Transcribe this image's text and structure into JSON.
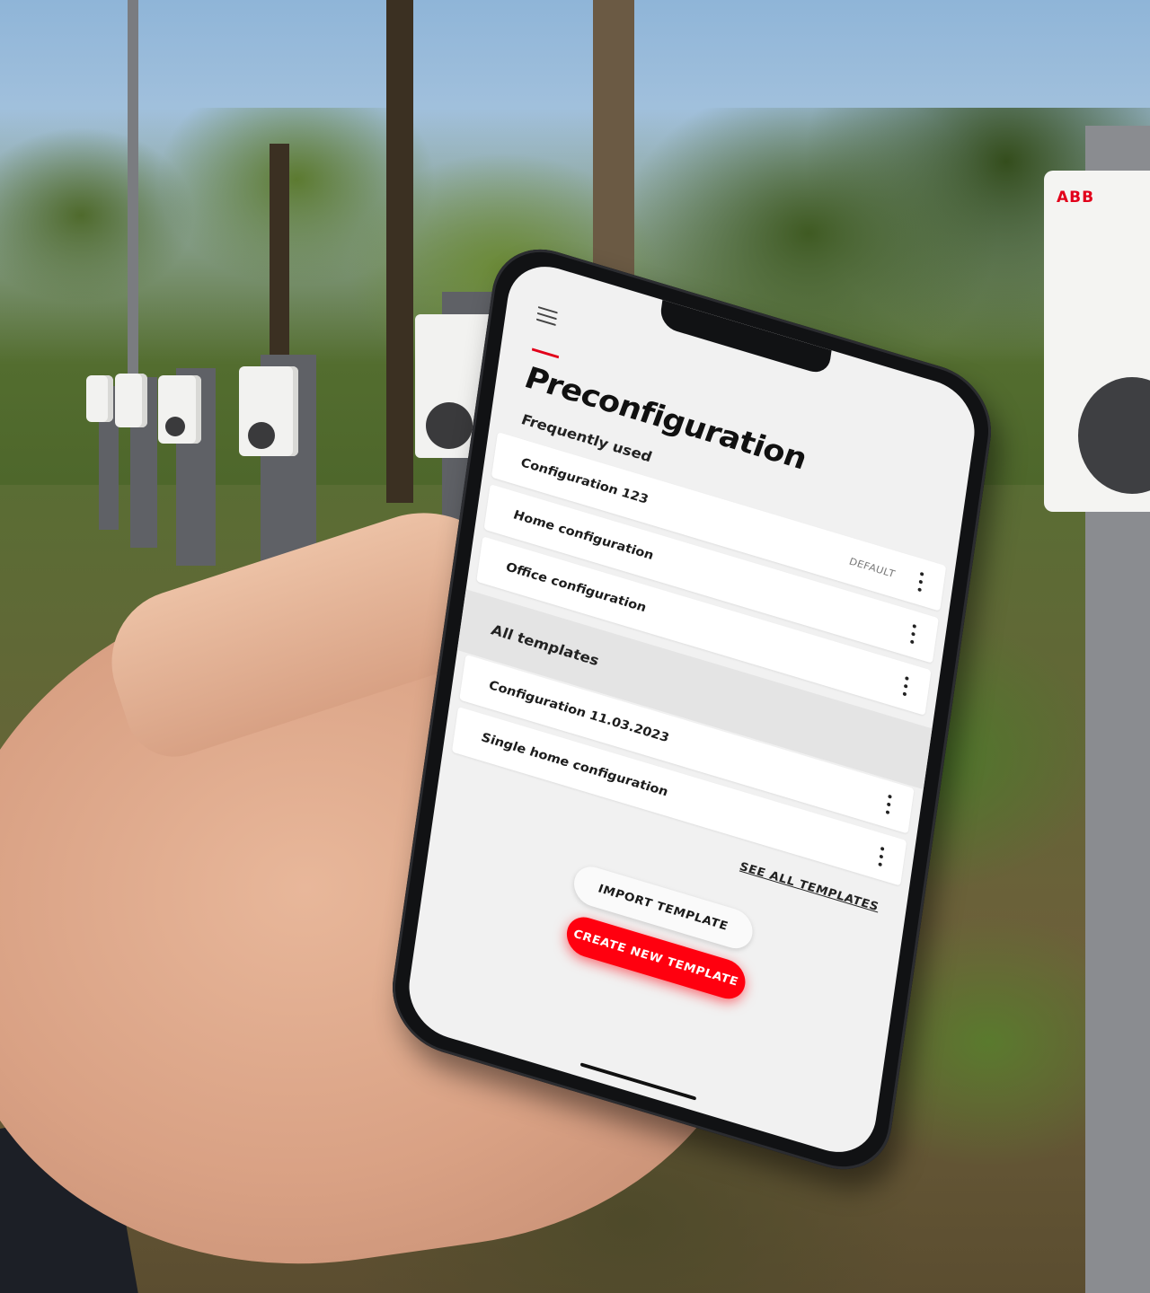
{
  "photo": {
    "charger_brand": "ABB"
  },
  "app": {
    "title": "Preconfiguration",
    "menu_icon": "hamburger-menu-icon",
    "accent_color": "#e2001a",
    "frequently_used": {
      "heading": "Frequently used",
      "items": [
        {
          "label": "Configuration 123",
          "badge": "DEFAULT"
        },
        {
          "label": "Home configuration",
          "badge": ""
        },
        {
          "label": "Office configuration",
          "badge": ""
        }
      ]
    },
    "all_templates": {
      "heading": "All templates",
      "items": [
        {
          "label": "Configuration 11.03.2023"
        },
        {
          "label": "Single home configuration"
        }
      ],
      "see_all_label": "SEE ALL TEMPLATES"
    },
    "actions": {
      "import_label": "IMPORT TEMPLATE",
      "create_label": "CREATE NEW TEMPLATE",
      "primary_color": "#ff000f"
    }
  }
}
